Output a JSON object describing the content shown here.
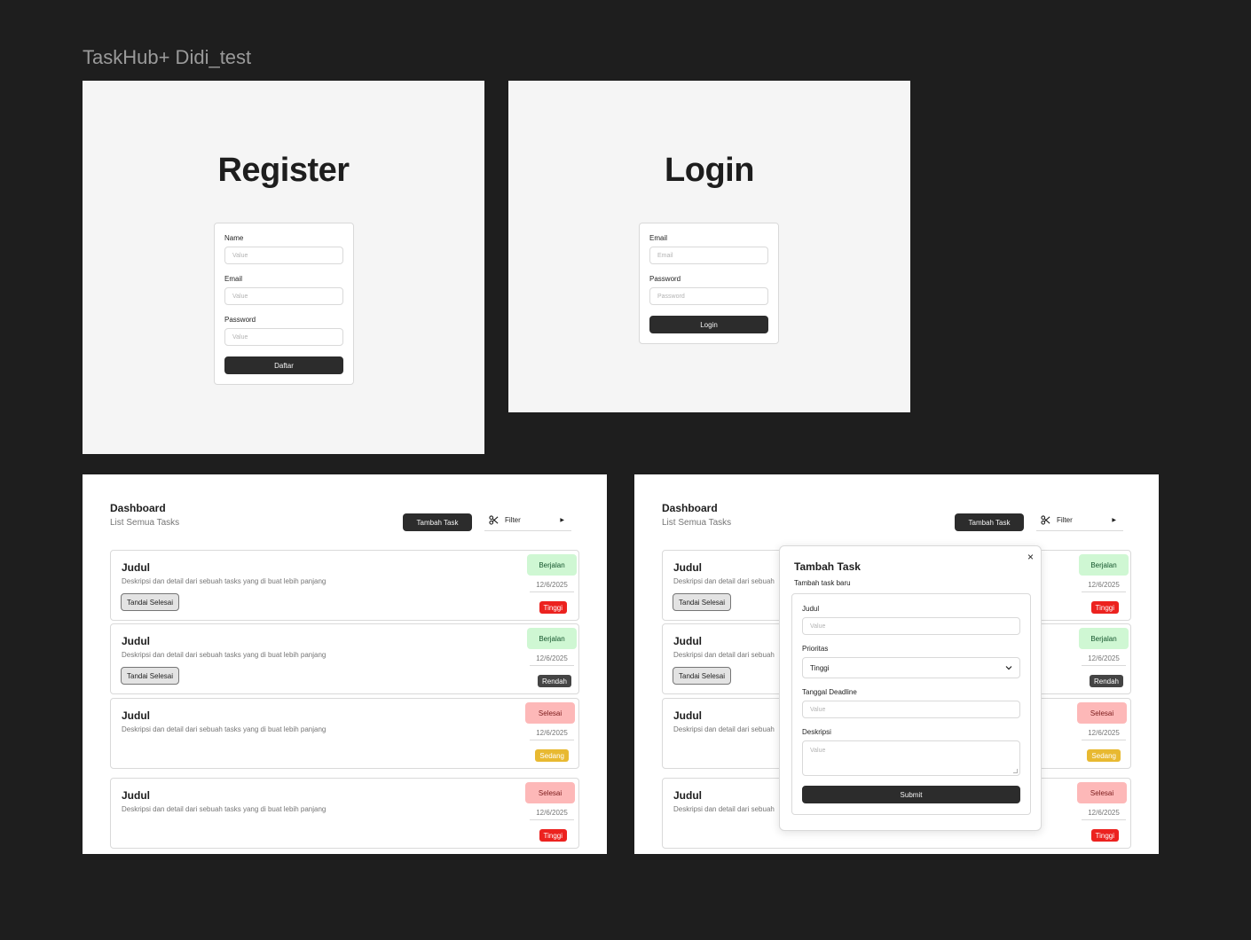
{
  "canvas": {
    "title": "TaskHub+ Didi_test"
  },
  "register": {
    "title": "Register",
    "fields": [
      {
        "label": "Name",
        "placeholder": "Value"
      },
      {
        "label": "Email",
        "placeholder": "Value"
      },
      {
        "label": "Password",
        "placeholder": "Value"
      }
    ],
    "submit_label": "Daftar"
  },
  "login": {
    "title": "Login",
    "fields": [
      {
        "label": "Email",
        "placeholder": "Email"
      },
      {
        "label": "Password",
        "placeholder": "Password"
      }
    ],
    "submit_label": "Login"
  },
  "dashboard": {
    "title": "Dashboard",
    "subtitle": "List Semua Tasks",
    "add_label": "Tambah Task",
    "filter_label": "Filter",
    "tasks": [
      {
        "title": "Judul",
        "desc": "Deskripsi dan detail dari sebuah tasks yang di buat lebih panjang",
        "action": "Tandai Selesai",
        "status": "Berjalan",
        "date": "12/6/2025",
        "priority": "Tinggi"
      },
      {
        "title": "Judul",
        "desc": "Deskripsi dan detail dari sebuah tasks yang di buat lebih panjang",
        "action": "Tandai Selesai",
        "status": "Berjalan",
        "date": "12/6/2025",
        "priority": "Rendah"
      },
      {
        "title": "Judul",
        "desc": "Deskripsi dan detail dari sebuah tasks yang di buat lebih panjang",
        "status": "Selesai",
        "date": "12/6/2025",
        "priority": "Sedang"
      },
      {
        "title": "Judul",
        "desc": "Deskripsi dan detail dari sebuah tasks yang di buat lebih panjang",
        "status": "Selesai",
        "date": "12/6/2025",
        "priority": "Tinggi"
      }
    ]
  },
  "dashboard_modal": {
    "title": "Dashboard",
    "subtitle": "List Semua Tasks",
    "add_label": "Tambah Task",
    "filter_label": "Filter",
    "tasks": [
      {
        "title": "Judul",
        "desc": "Deskripsi dan detail dari sebuah",
        "action": "Tandai Selesai",
        "status": "Berjalan",
        "date": "12/6/2025",
        "priority": "Tinggi"
      },
      {
        "title": "Judul",
        "desc": "Deskripsi dan detail dari sebuah",
        "action": "Tandai Selesai",
        "status": "Berjalan",
        "date": "12/6/2025",
        "priority": "Rendah"
      },
      {
        "title": "Judul",
        "desc": "Deskripsi dan detail dari sebuah",
        "status": "Selesai",
        "date": "12/6/2025",
        "priority": "Sedang"
      },
      {
        "title": "Judul",
        "desc": "Deskripsi dan detail dari sebuah",
        "status": "Selesai",
        "date": "12/6/2025",
        "priority": "Tinggi"
      }
    ],
    "modal": {
      "title": "Tambah Task",
      "subtitle": "Tambah task baru",
      "judul_label": "Judul",
      "judul_placeholder": "Value",
      "prioritas_label": "Prioritas",
      "prioritas_value": "Tinggi",
      "deadline_label": "Tanggal Deadline",
      "deadline_placeholder": "Value",
      "deskripsi_label": "Deskripsi",
      "deskripsi_placeholder": "Value",
      "submit_label": "Submit",
      "close_icon": "×"
    }
  },
  "colors": {
    "canvas_bg": "#1e1e1e",
    "frame_grey": "#f5f5f5",
    "button_dark": "#2c2c2c",
    "status_running": "#cff7d3",
    "status_done": "#fdb8b8",
    "priority_high": "#ec221f",
    "priority_medium": "#e8b931",
    "priority_low": "#444444"
  },
  "icons": {
    "filter": "scissors-icon",
    "filter_caret": "caret-right-icon",
    "select_caret": "chevron-down-icon",
    "close": "close-icon"
  }
}
